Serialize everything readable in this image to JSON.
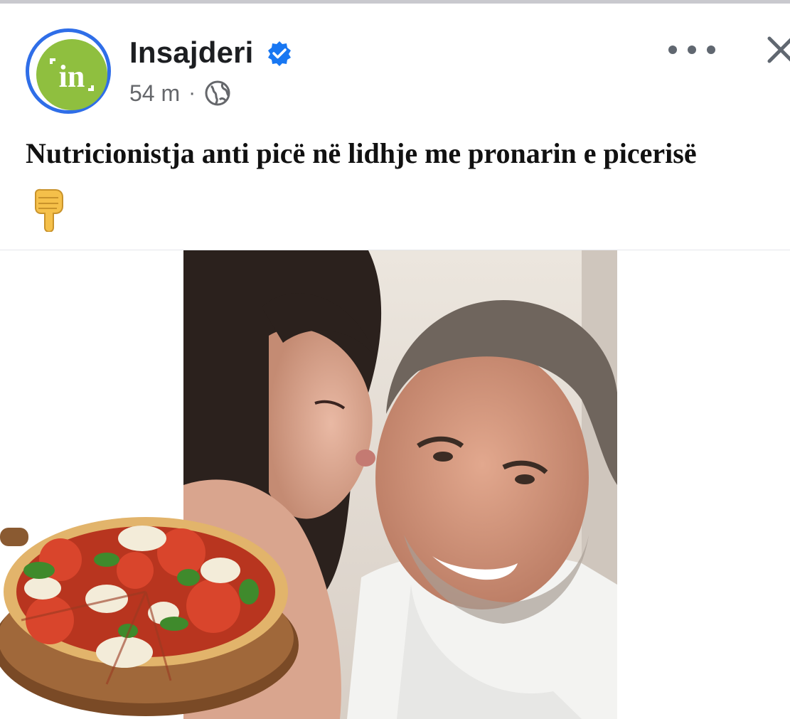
{
  "post": {
    "page_name": "Insajderi",
    "avatar_icon": "insajderi-logo-icon",
    "verified_icon": "verified-badge-icon",
    "time": "54 m",
    "separator": "·",
    "audience_icon": "globe-icon",
    "text": "Nutricionistja anti picë në lidhje me pronarin e picerisë",
    "emoji_icon": "backhand-index-pointing-down-icon",
    "more_icon": "more-options-icon",
    "close_icon": "close-icon"
  },
  "image": {
    "photo": "couple-kiss-photo",
    "overlay": "pizza-on-board-image"
  },
  "colors": {
    "brand_blue": "#2f6ee8",
    "logo_green": "#8fbf3f",
    "text_primary": "#1c1e21",
    "text_secondary": "#65676b",
    "verified_blue": "#1877f2"
  }
}
